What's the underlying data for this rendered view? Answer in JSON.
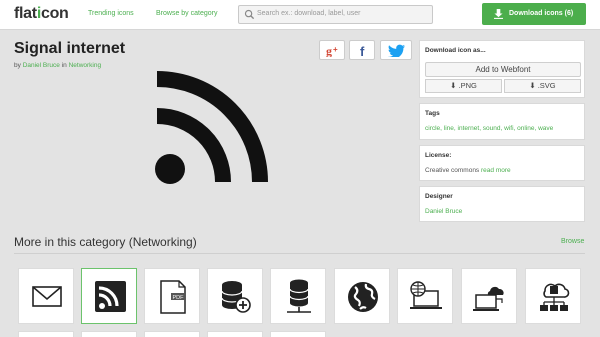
{
  "header": {
    "logo_prefix": "flat",
    "logo_accent": "i",
    "logo_suffix": "con",
    "nav": [
      "Trending icons",
      "Browse by category"
    ],
    "search_placeholder": "Search ex.: download, label, user",
    "download_button": "Download icons (6)"
  },
  "icon": {
    "title": "Signal internet",
    "by_text": "by",
    "author": "Daniel Bruce",
    "in_text": "in",
    "category": "Networking"
  },
  "share": [
    "google-plus-icon",
    "facebook-icon",
    "twitter-icon"
  ],
  "panel": {
    "download_title": "Download icon as...",
    "webfont_button": "Add to Webfont",
    "png_button": "⬇ .PNG",
    "svg_button": "⬇ .SVG",
    "tags_title": "Tags",
    "tags_value": "circle, line, internet, sound, wifi, online, wave",
    "license_title": "License:",
    "license_text": "Creative commons",
    "license_link": "read more",
    "designer_title": "Designer",
    "designer_name": "Daniel Bruce"
  },
  "more": {
    "title": "More in this category (Networking)",
    "browse": "Browse",
    "thumb_labels": [
      "PDF"
    ],
    "thumbs": [
      "envelope-icon",
      "rss-icon",
      "pdf-file-icon",
      "database-add-icon",
      "database-network-icon",
      "globe-icon",
      "laptop-globe-icon",
      "cloud-laptop-icon",
      "cloud-network-icon"
    ]
  },
  "colors": {
    "accent": "#4caf50",
    "background": "#e3e3e3",
    "icon": "#111111"
  }
}
